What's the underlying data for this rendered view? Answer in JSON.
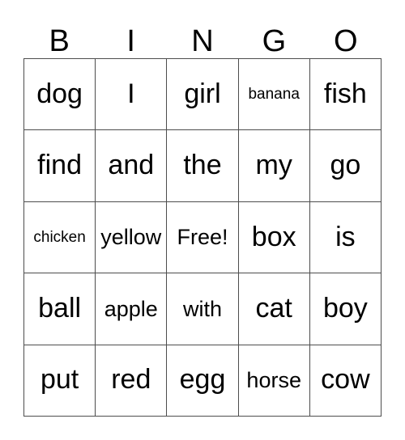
{
  "card": {
    "title": "BINGO",
    "header_letters": [
      "B",
      "I",
      "N",
      "G",
      "O"
    ],
    "free_space_label": "Free!",
    "colors": {
      "grid_line": "#4d4d4d",
      "text": "#000000",
      "background": "#ffffff"
    },
    "rows": [
      [
        {
          "text": "dog",
          "size": "lg"
        },
        {
          "text": "I",
          "size": "lg"
        },
        {
          "text": "girl",
          "size": "lg"
        },
        {
          "text": "banana",
          "size": "sm"
        },
        {
          "text": "fish",
          "size": "lg"
        }
      ],
      [
        {
          "text": "find",
          "size": "lg"
        },
        {
          "text": "and",
          "size": "lg"
        },
        {
          "text": "the",
          "size": "lg"
        },
        {
          "text": "my",
          "size": "lg"
        },
        {
          "text": "go",
          "size": "lg"
        }
      ],
      [
        {
          "text": "chicken",
          "size": "sm"
        },
        {
          "text": "yellow",
          "size": "md"
        },
        {
          "text": "Free!",
          "size": "md"
        },
        {
          "text": "box",
          "size": "lg"
        },
        {
          "text": "is",
          "size": "lg"
        }
      ],
      [
        {
          "text": "ball",
          "size": "lg"
        },
        {
          "text": "apple",
          "size": "md"
        },
        {
          "text": "with",
          "size": "md"
        },
        {
          "text": "cat",
          "size": "lg"
        },
        {
          "text": "boy",
          "size": "lg"
        }
      ],
      [
        {
          "text": "put",
          "size": "lg"
        },
        {
          "text": "red",
          "size": "lg"
        },
        {
          "text": "egg",
          "size": "lg"
        },
        {
          "text": "horse",
          "size": "md"
        },
        {
          "text": "cow",
          "size": "lg"
        }
      ]
    ]
  }
}
